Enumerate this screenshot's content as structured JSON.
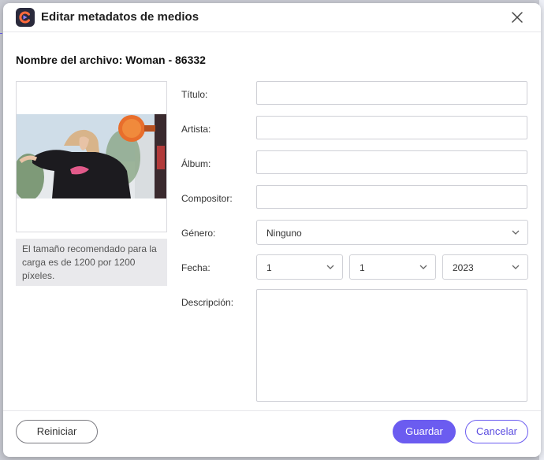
{
  "dialog": {
    "title": "Editar metadatos de medios",
    "filename": "Nombre del archivo: Woman - 86332",
    "thumbnail_note": "El tamaño recomendado para la carga es de 1200 por 1200 píxeles."
  },
  "fields": {
    "title_label": "Título:",
    "artist_label": "Artista:",
    "album_label": "Álbum:",
    "composer_label": "Compositor:",
    "genre_label": "Género:",
    "date_label": "Fecha:",
    "description_label": "Descripción:",
    "title_value": "",
    "artist_value": "",
    "album_value": "",
    "composer_value": "",
    "description_value": ""
  },
  "genre": {
    "selected": "Ninguno"
  },
  "date": {
    "day": "1",
    "month": "1",
    "year": "2023"
  },
  "buttons": {
    "reset": "Reiniciar",
    "save": "Guardar",
    "cancel": "Cancelar"
  },
  "colors": {
    "accent": "#6b5cf0"
  },
  "icons": {
    "app": "app-logo-icon",
    "close": "close-icon",
    "chevron": "chevron-down-icon"
  }
}
